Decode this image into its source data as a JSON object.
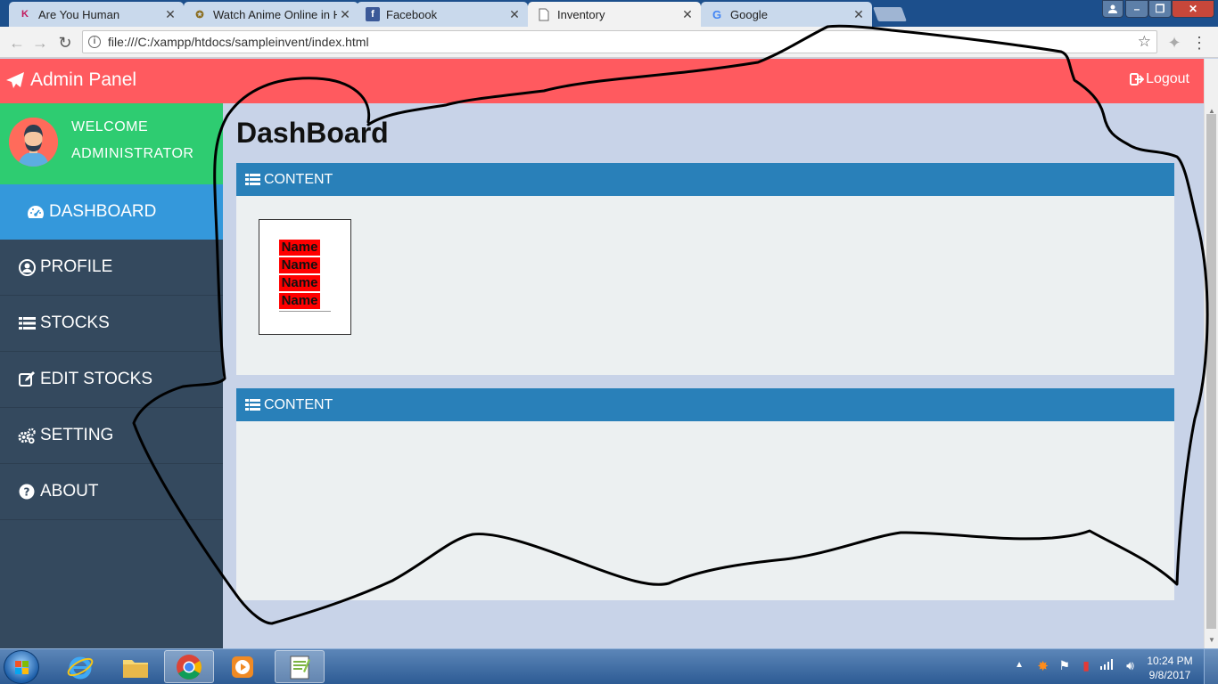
{
  "browser": {
    "tabs": [
      {
        "label": "Are You Human",
        "active": false
      },
      {
        "label": "Watch Anime Online in H",
        "active": false
      },
      {
        "label": "Facebook",
        "active": false
      },
      {
        "label": "Inventory",
        "active": true
      },
      {
        "label": "Google",
        "active": false
      }
    ],
    "url": "file:///C:/xampp/htdocs/sampleinvent/index.html"
  },
  "header": {
    "brand": "Admin Panel",
    "logout": "Logout",
    "color": "#ff5a5f"
  },
  "sidebar": {
    "welcome_line1": "WELCOME",
    "welcome_line2": "ADMINISTRATOR",
    "items": [
      {
        "label": "DASHBOARD",
        "icon": "dashboard-icon",
        "active": true
      },
      {
        "label": "PROFILE",
        "icon": "user-circle-icon",
        "active": false
      },
      {
        "label": "STOCKS",
        "icon": "list-icon",
        "active": false
      },
      {
        "label": "EDIT STOCKS",
        "icon": "edit-icon",
        "active": false
      },
      {
        "label": "SETTING",
        "icon": "gears-icon",
        "active": false
      },
      {
        "label": "ABOUT",
        "icon": "question-circle-icon",
        "active": false
      }
    ]
  },
  "main": {
    "title": "DashBoard",
    "panels": [
      {
        "heading": "CONTENT"
      },
      {
        "heading": "CONTENT"
      }
    ],
    "thumbnail_rows": [
      "Name",
      "Name",
      "Name",
      "Name"
    ]
  },
  "taskbar": {
    "time": "10:24 PM",
    "date": "9/8/2017"
  }
}
